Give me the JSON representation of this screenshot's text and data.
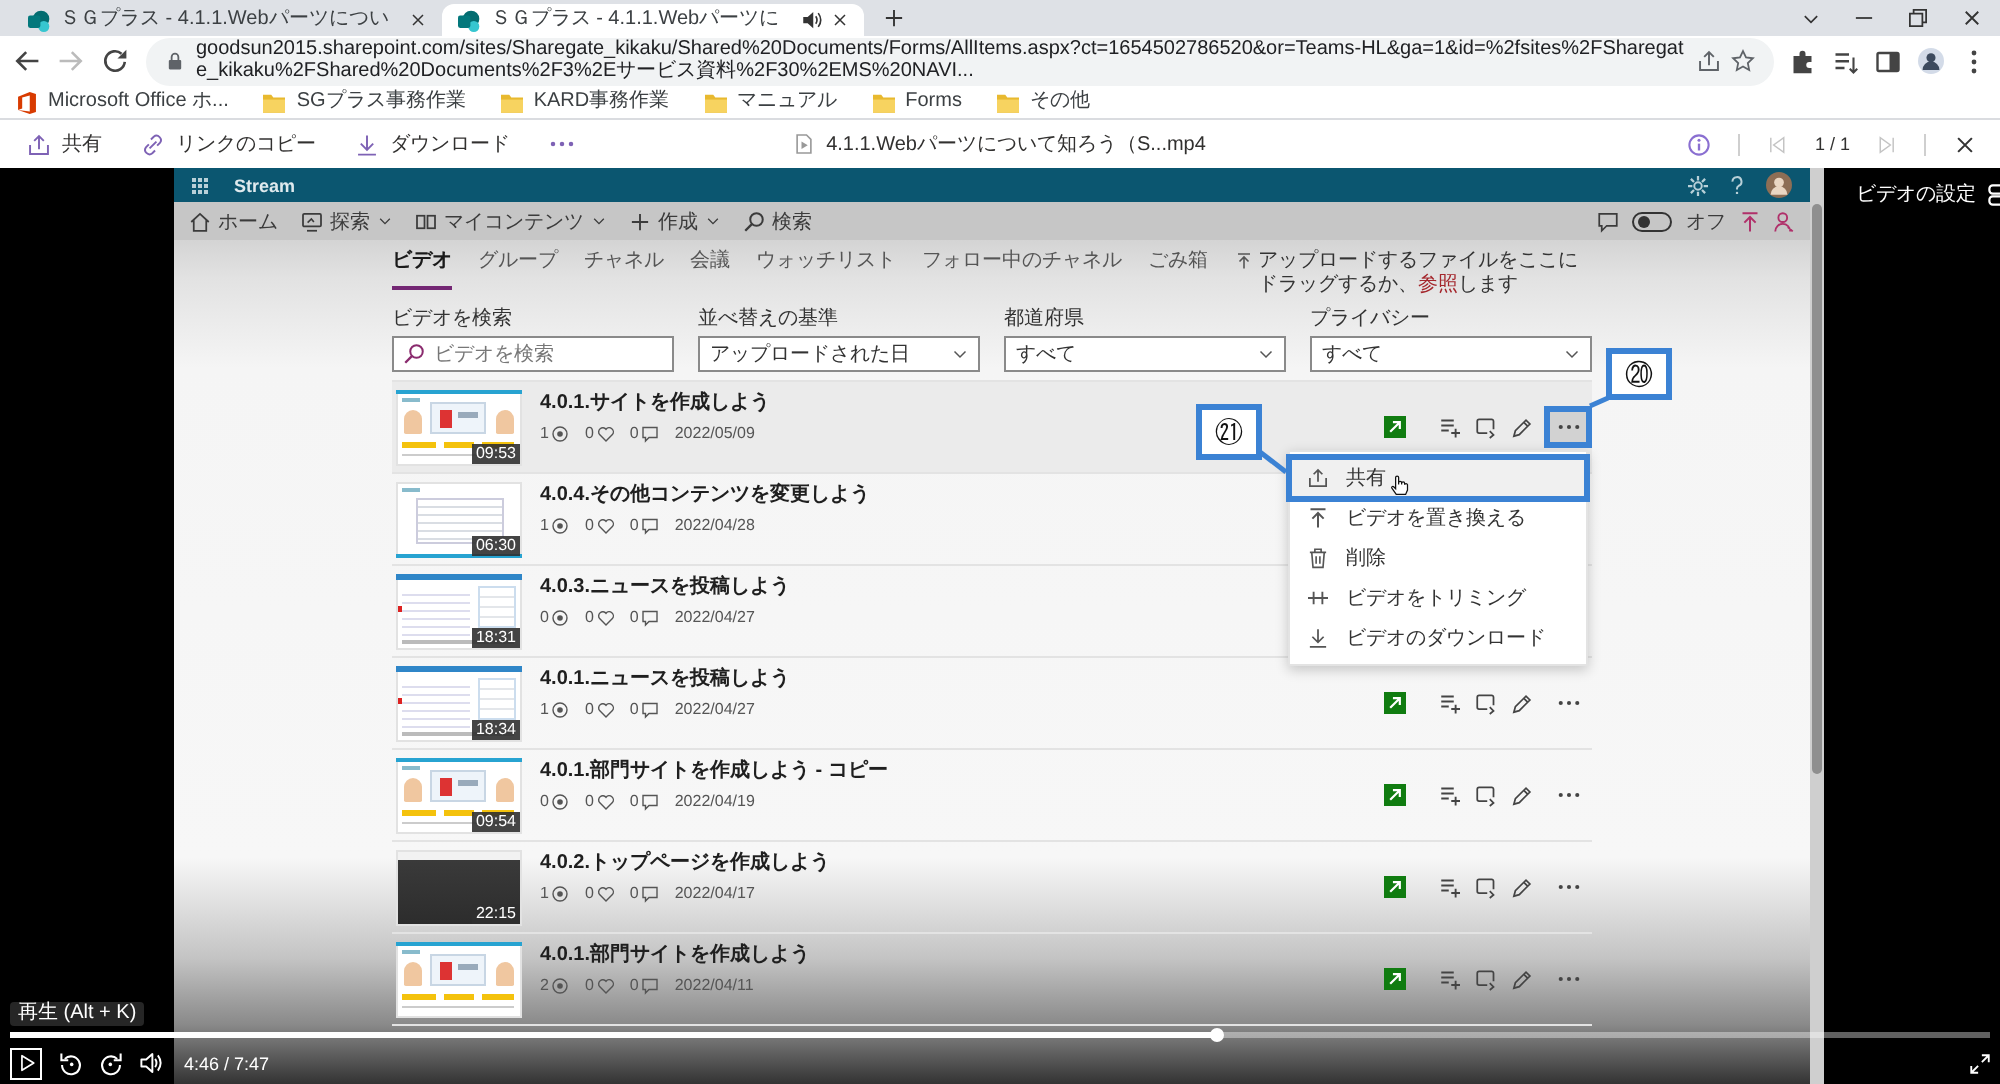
{
  "browser": {
    "tabs": [
      {
        "title": "ＳＧプラス - 4.1.1.Webパーツについ",
        "selected": false,
        "playing_audio": false
      },
      {
        "title": "ＳＧプラス - 4.1.1.Webパーツに",
        "selected": true,
        "playing_audio": true
      }
    ],
    "can_go_forward": false,
    "address": "goodsun2015.sharepoint.com/sites/Sharegate_kikaku/Shared%20Documents/Forms/AllItems.aspx?ct=1654502786520&or=Teams-HL&ga=1&id=%2fsites%2FSharegate_kikaku%2FShared%20Documents%2F3%2Eサービス資料%2F30%2EMS%20NAVI...",
    "bookmarks": [
      {
        "label": "Microsoft Office ホ...",
        "kind": "app"
      },
      {
        "label": "SGプラス事務作業",
        "kind": "folder"
      },
      {
        "label": "KARD事務作業",
        "kind": "folder"
      },
      {
        "label": "マニュアル",
        "kind": "folder"
      },
      {
        "label": "Forms",
        "kind": "folder"
      },
      {
        "label": "その他",
        "kind": "folder"
      }
    ]
  },
  "viewer": {
    "actions": [
      {
        "label": "共有"
      },
      {
        "label": "リンクのコピー"
      },
      {
        "label": "ダウンロード"
      }
    ],
    "file_name": "4.1.1.Webパーツについて知ろう（S...mp4",
    "pager": {
      "label": "1 / 1",
      "prev_disabled": true,
      "next_disabled": true
    },
    "settings_label": "ビデオの設定"
  },
  "stream": {
    "app_name": "Stream",
    "nav": [
      {
        "label": "ホーム",
        "dropdown": false
      },
      {
        "label": "探索",
        "dropdown": true
      },
      {
        "label": "マイコンテンツ",
        "dropdown": true
      },
      {
        "label": "作成",
        "dropdown": true
      },
      {
        "label": "検索",
        "dropdown": false
      }
    ],
    "toggle": {
      "label": "オフ",
      "on": false
    },
    "tabs": [
      {
        "label": "ビデオ",
        "selected": true
      },
      {
        "label": "グループ",
        "selected": false
      },
      {
        "label": "チャネル",
        "selected": false
      },
      {
        "label": "会議",
        "selected": false
      },
      {
        "label": "ウォッチリスト",
        "selected": false
      },
      {
        "label": "フォロー中のチャネル",
        "selected": false
      },
      {
        "label": "ごみ箱",
        "selected": false
      }
    ],
    "upload_hint": {
      "text": "アップロードするファイルをここにドラッグするか、",
      "link": "参照",
      "after": "します"
    },
    "filters": [
      {
        "label": "ビデオを検索",
        "kind": "search",
        "placeholder": "ビデオを検索"
      },
      {
        "label": "並べ替えの基準",
        "kind": "dropdown",
        "value": "アップロードされた日"
      },
      {
        "label": "都道府県",
        "kind": "dropdown",
        "value": "すべて"
      },
      {
        "label": "プライバシー",
        "kind": "dropdown",
        "value": "すべて"
      }
    ],
    "videos": [
      {
        "title": "4.0.1.サイトを作成しよう",
        "views": "1",
        "likes": "0",
        "comments": "0",
        "date": "2022/05/09",
        "duration": "09:53",
        "kind": "slides",
        "menu_open": true
      },
      {
        "title": "4.0.4.その他コンテンツを変更しよう",
        "views": "1",
        "likes": "0",
        "comments": "0",
        "date": "2022/04/28",
        "duration": "06:30",
        "kind": "table",
        "menu_open": false
      },
      {
        "title": "4.0.3.ニュースを投稿しよう",
        "views": "0",
        "likes": "0",
        "comments": "0",
        "date": "2022/04/27",
        "duration": "18:31",
        "kind": "page",
        "menu_open": false
      },
      {
        "title": "4.0.1.ニュースを投稿しよう",
        "views": "1",
        "likes": "0",
        "comments": "0",
        "date": "2022/04/27",
        "duration": "18:34",
        "kind": "page",
        "menu_open": false
      },
      {
        "title": "4.0.1.部門サイトを作成しよう - コピー",
        "views": "0",
        "likes": "0",
        "comments": "0",
        "date": "2022/04/19",
        "duration": "09:54",
        "kind": "slides",
        "menu_open": false
      },
      {
        "title": "4.0.2.トップページを作成しよう",
        "views": "1",
        "likes": "0",
        "comments": "0",
        "date": "2022/04/17",
        "duration": "22:15",
        "kind": "photo",
        "menu_open": false
      },
      {
        "title": "4.0.1.部門サイトを作成しよう",
        "views": "2",
        "likes": "0",
        "comments": "0",
        "date": "2022/04/11",
        "kind": "slides",
        "menu_open": false
      }
    ],
    "menu": {
      "items": [
        {
          "label": "共有",
          "hovered": true
        },
        {
          "label": "ビデオを置き換える",
          "hovered": false
        },
        {
          "label": "削除",
          "hovered": false
        },
        {
          "label": "ビデオをトリミング",
          "hovered": false
        },
        {
          "label": "ビデオのダウンロード",
          "hovered": false
        }
      ]
    }
  },
  "annotations": [
    {
      "label": "⑳"
    },
    {
      "label": "㉑"
    }
  ],
  "player": {
    "tooltip": "再生 (Alt + K)",
    "level": 0.61,
    "time": "4:46 / 7:47"
  }
}
